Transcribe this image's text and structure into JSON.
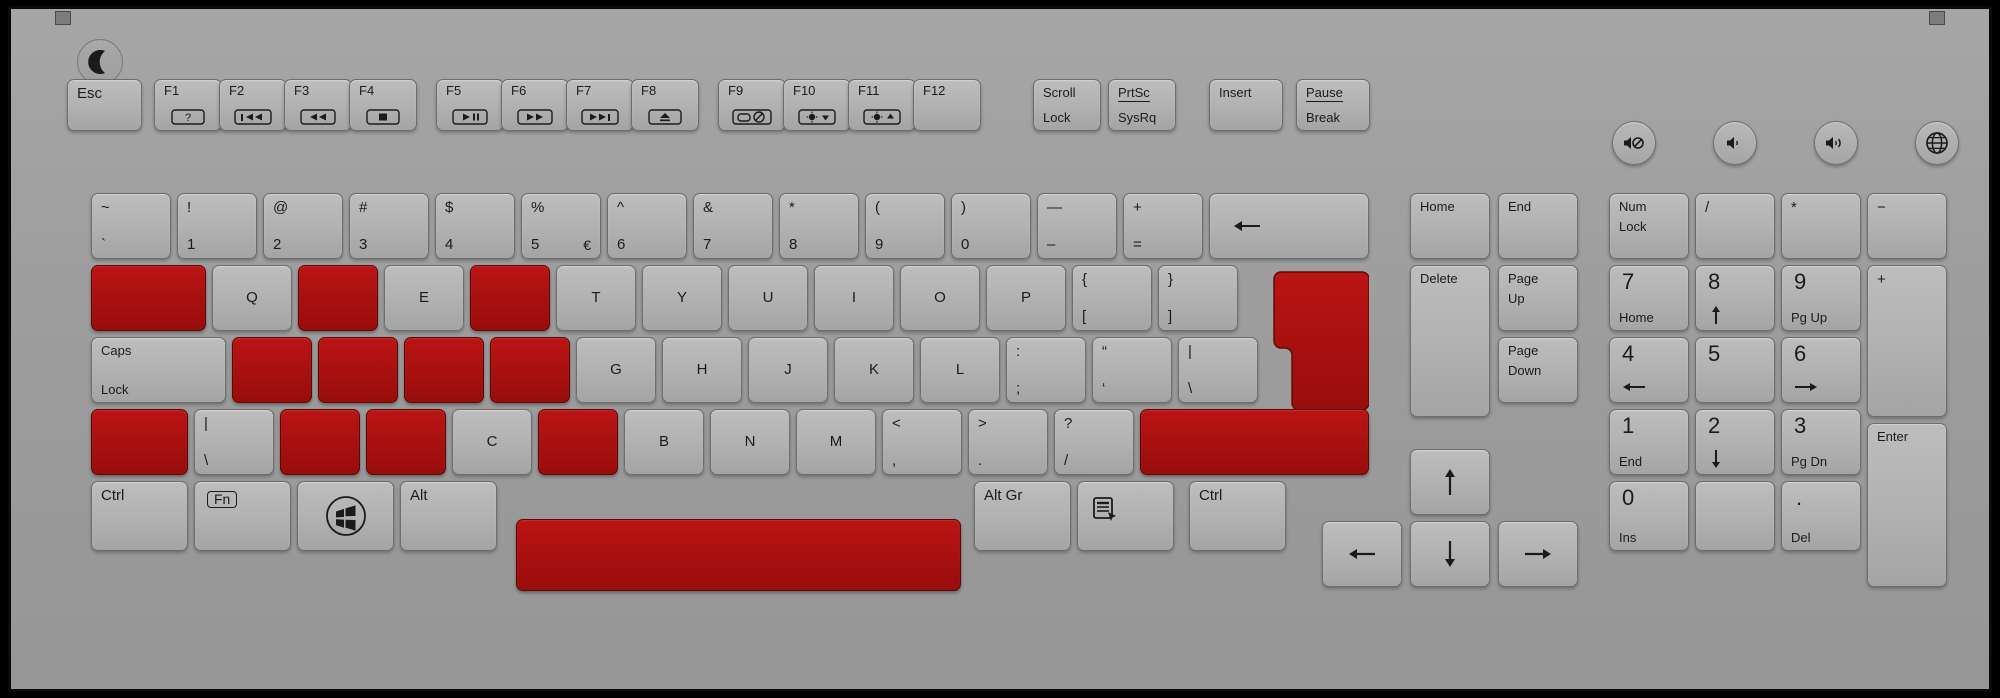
{
  "device": {
    "type": "laptop-keyboard",
    "layout": "ISO full-size with numeric keypad",
    "body_color": "#a0a0a0",
    "key_color": "#b2b2b2",
    "highlight_color": "#a81010",
    "highlight_meaning": "blank red keys"
  },
  "indicators": [
    {
      "name": "sleep-indicator",
      "icon": "moon-icon"
    }
  ],
  "media_buttons": [
    {
      "name": "mute",
      "icon": "speaker-mute-icon"
    },
    {
      "name": "volume-down",
      "icon": "speaker-low-icon"
    },
    {
      "name": "volume-up",
      "icon": "speaker-high-icon"
    },
    {
      "name": "internet",
      "icon": "globe-icon"
    }
  ],
  "rows": {
    "function_row": [
      {
        "id": "esc",
        "top": "Esc"
      },
      {
        "id": "f1",
        "top": "F1",
        "icon": "help-icon"
      },
      {
        "id": "f2",
        "top": "F2",
        "icon": "prev-track-icon"
      },
      {
        "id": "f3",
        "top": "F3",
        "icon": "rewind-icon"
      },
      {
        "id": "f4",
        "top": "F4",
        "icon": "stop-icon"
      },
      {
        "id": "f5",
        "top": "F5",
        "icon": "play-pause-icon"
      },
      {
        "id": "f6",
        "top": "F6",
        "icon": "fast-forward-icon"
      },
      {
        "id": "f7",
        "top": "F7",
        "icon": "next-track-icon"
      },
      {
        "id": "f8",
        "top": "F8",
        "icon": "eject-icon"
      },
      {
        "id": "f9",
        "top": "F9",
        "icon": "touchpad-toggle-icon"
      },
      {
        "id": "f10",
        "top": "F10",
        "icon": "brightness-down-icon"
      },
      {
        "id": "f11",
        "top": "F11",
        "icon": "brightness-up-icon"
      },
      {
        "id": "f12",
        "top": "F12"
      },
      {
        "id": "scroll-lock",
        "top": "Scroll",
        "bottom": "Lock"
      },
      {
        "id": "prtsc",
        "top": "PrtSc",
        "bottom": "SysRq",
        "divider": true
      },
      {
        "id": "insert",
        "top": "Insert"
      },
      {
        "id": "pause",
        "top": "Pause",
        "bottom": "Break",
        "divider": true
      }
    ],
    "number_row": [
      {
        "id": "backtick",
        "top": "~",
        "bottom": "`"
      },
      {
        "id": "digit-1",
        "top": "!",
        "bottom": "1"
      },
      {
        "id": "digit-2",
        "top": "@",
        "bottom": "2"
      },
      {
        "id": "digit-3",
        "top": "#",
        "bottom": "3"
      },
      {
        "id": "digit-4",
        "top": "$",
        "bottom": "4"
      },
      {
        "id": "digit-5",
        "top": "%",
        "bottom": "5",
        "alt": "€"
      },
      {
        "id": "digit-6",
        "top": "^",
        "bottom": "6"
      },
      {
        "id": "digit-7",
        "top": "&",
        "bottom": "7"
      },
      {
        "id": "digit-8",
        "top": "*",
        "bottom": "8"
      },
      {
        "id": "digit-9",
        "top": "(",
        "bottom": "9"
      },
      {
        "id": "digit-0",
        "top": ")",
        "bottom": "0"
      },
      {
        "id": "minus",
        "top": "—",
        "bottom": "–"
      },
      {
        "id": "equal",
        "top": "+",
        "bottom": "="
      },
      {
        "id": "backspace",
        "icon": "arrow-left-icon"
      }
    ],
    "qwerty_row": [
      {
        "id": "tab",
        "highlight": true
      },
      {
        "id": "q",
        "center": "Q"
      },
      {
        "id": "w",
        "highlight": true
      },
      {
        "id": "e",
        "center": "E"
      },
      {
        "id": "r",
        "highlight": true
      },
      {
        "id": "t",
        "center": "T"
      },
      {
        "id": "y",
        "center": "Y"
      },
      {
        "id": "u",
        "center": "U"
      },
      {
        "id": "i",
        "center": "I"
      },
      {
        "id": "o",
        "center": "O"
      },
      {
        "id": "p",
        "center": "P"
      },
      {
        "id": "bracket-left",
        "top": "{",
        "bottom": "["
      },
      {
        "id": "bracket-right",
        "top": "}",
        "bottom": "]"
      },
      {
        "id": "enter",
        "highlight": true,
        "shape": "iso-l"
      }
    ],
    "home_row": [
      {
        "id": "caps-lock",
        "top": "Caps",
        "bottom": "Lock"
      },
      {
        "id": "a",
        "highlight": true
      },
      {
        "id": "s",
        "highlight": true
      },
      {
        "id": "d",
        "highlight": true
      },
      {
        "id": "f",
        "highlight": true
      },
      {
        "id": "g",
        "center": "G"
      },
      {
        "id": "h",
        "center": "H"
      },
      {
        "id": "j",
        "center": "J"
      },
      {
        "id": "k",
        "center": "K"
      },
      {
        "id": "l",
        "center": "L"
      },
      {
        "id": "semicolon",
        "top": ":",
        "bottom": ";"
      },
      {
        "id": "quote",
        "top": "“",
        "bottom": "‘"
      },
      {
        "id": "backslash",
        "top": "|",
        "bottom": "\\"
      }
    ],
    "shift_row": [
      {
        "id": "shift-left",
        "highlight": true
      },
      {
        "id": "backslash-iso",
        "top": "|",
        "bottom": "\\"
      },
      {
        "id": "z",
        "highlight": true
      },
      {
        "id": "x",
        "highlight": true
      },
      {
        "id": "c",
        "center": "C"
      },
      {
        "id": "v",
        "highlight": true
      },
      {
        "id": "b",
        "center": "B"
      },
      {
        "id": "n",
        "center": "N"
      },
      {
        "id": "m",
        "center": "M"
      },
      {
        "id": "comma",
        "top": "<",
        "bottom": ","
      },
      {
        "id": "period",
        "top": ">",
        "bottom": "."
      },
      {
        "id": "slash",
        "top": "?",
        "bottom": "/"
      },
      {
        "id": "shift-right",
        "highlight": true
      }
    ],
    "modifier_row": [
      {
        "id": "ctrl-left",
        "top": "Ctrl"
      },
      {
        "id": "fn",
        "top": "Fn",
        "boxed": true
      },
      {
        "id": "win",
        "icon": "windows-logo-icon"
      },
      {
        "id": "alt-left",
        "top": "Alt"
      },
      {
        "id": "space",
        "highlight": true
      },
      {
        "id": "alt-gr",
        "top": "Alt Gr"
      },
      {
        "id": "menu",
        "icon": "context-menu-icon"
      },
      {
        "id": "ctrl-right",
        "top": "Ctrl"
      }
    ]
  },
  "nav_cluster": [
    {
      "id": "home",
      "top": "Home"
    },
    {
      "id": "end",
      "top": "End"
    },
    {
      "id": "delete",
      "top": "Delete"
    },
    {
      "id": "page-up",
      "top": "Page",
      "bottom2": "Up"
    },
    {
      "id": "page-down",
      "top": "Page",
      "bottom2": "Down"
    },
    {
      "id": "arrow-up",
      "icon": "arrow-up-icon"
    },
    {
      "id": "arrow-left",
      "icon": "arrow-left-icon"
    },
    {
      "id": "arrow-down",
      "icon": "arrow-down-icon"
    },
    {
      "id": "arrow-right",
      "icon": "arrow-right-icon"
    }
  ],
  "numpad": [
    {
      "id": "num-lock",
      "top": "Num",
      "bottom": "Lock"
    },
    {
      "id": "num-divide",
      "top": "/"
    },
    {
      "id": "num-multiply",
      "top": "*"
    },
    {
      "id": "num-subtract",
      "top": "−"
    },
    {
      "id": "num-7",
      "big": "7",
      "sub": "Home"
    },
    {
      "id": "num-8",
      "big": "8",
      "subicon": "arrow-up-icon"
    },
    {
      "id": "num-9",
      "big": "9",
      "sub": "Pg Up"
    },
    {
      "id": "num-add",
      "top": "+"
    },
    {
      "id": "num-4",
      "big": "4",
      "subicon": "arrow-left-icon"
    },
    {
      "id": "num-5",
      "big": "5"
    },
    {
      "id": "num-6",
      "big": "6",
      "subicon": "arrow-right-icon"
    },
    {
      "id": "num-1",
      "big": "1",
      "sub": "End"
    },
    {
      "id": "num-2",
      "big": "2",
      "subicon": "arrow-down-icon"
    },
    {
      "id": "num-3",
      "big": "3",
      "sub": "Pg Dn"
    },
    {
      "id": "num-enter",
      "top": "Enter"
    },
    {
      "id": "num-0",
      "big": "0",
      "sub": "Ins"
    },
    {
      "id": "num-blank"
    },
    {
      "id": "num-decimal",
      "big": ".",
      "sub": "Del"
    }
  ]
}
